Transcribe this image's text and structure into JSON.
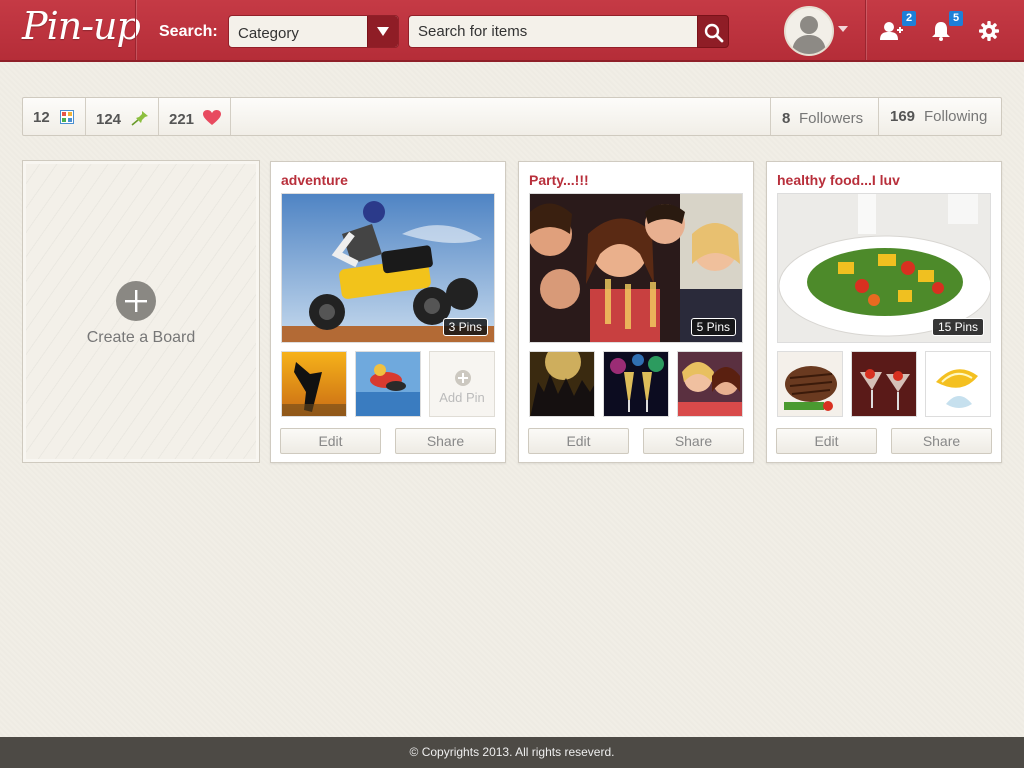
{
  "header": {
    "logo": "Pin-up",
    "search_label": "Search:",
    "category_value": "Category",
    "search_placeholder": "Search for items",
    "friend_requests_count": "2",
    "notifications_count": "5"
  },
  "stats": {
    "boards": "12",
    "pins": "124",
    "likes": "221",
    "followers_count": "8",
    "followers_label": "Followers",
    "following_count": "169",
    "following_label": "Following"
  },
  "create_board": {
    "label": "Create a Board"
  },
  "boards": [
    {
      "title": "adventure",
      "pin_count": "3 Pins",
      "thumbs": [
        "skydiver-silhouette",
        "tandem-skydivers"
      ],
      "add_pin_label": "Add Pin",
      "edit_label": "Edit",
      "share_label": "Share"
    },
    {
      "title": "Party...!!!",
      "pin_count": "5 Pins",
      "thumbs": [
        "concert-crowd",
        "champagne-glasses",
        "laughing-friends"
      ],
      "edit_label": "Edit",
      "share_label": "Share"
    },
    {
      "title": "healthy food...I luv",
      "pin_count": "15 Pins",
      "thumbs": [
        "grilled-steak",
        "shrimp-cocktail",
        "lemon-splash"
      ],
      "edit_label": "Edit",
      "share_label": "Share"
    }
  ],
  "footer": {
    "copyright": "© Copyrights 2013. All rights reseverd."
  },
  "colors": {
    "brand": "#c0343f",
    "brand_dark": "#8f1d26",
    "badge": "#1e7fd8",
    "footer": "#4d4a45"
  }
}
